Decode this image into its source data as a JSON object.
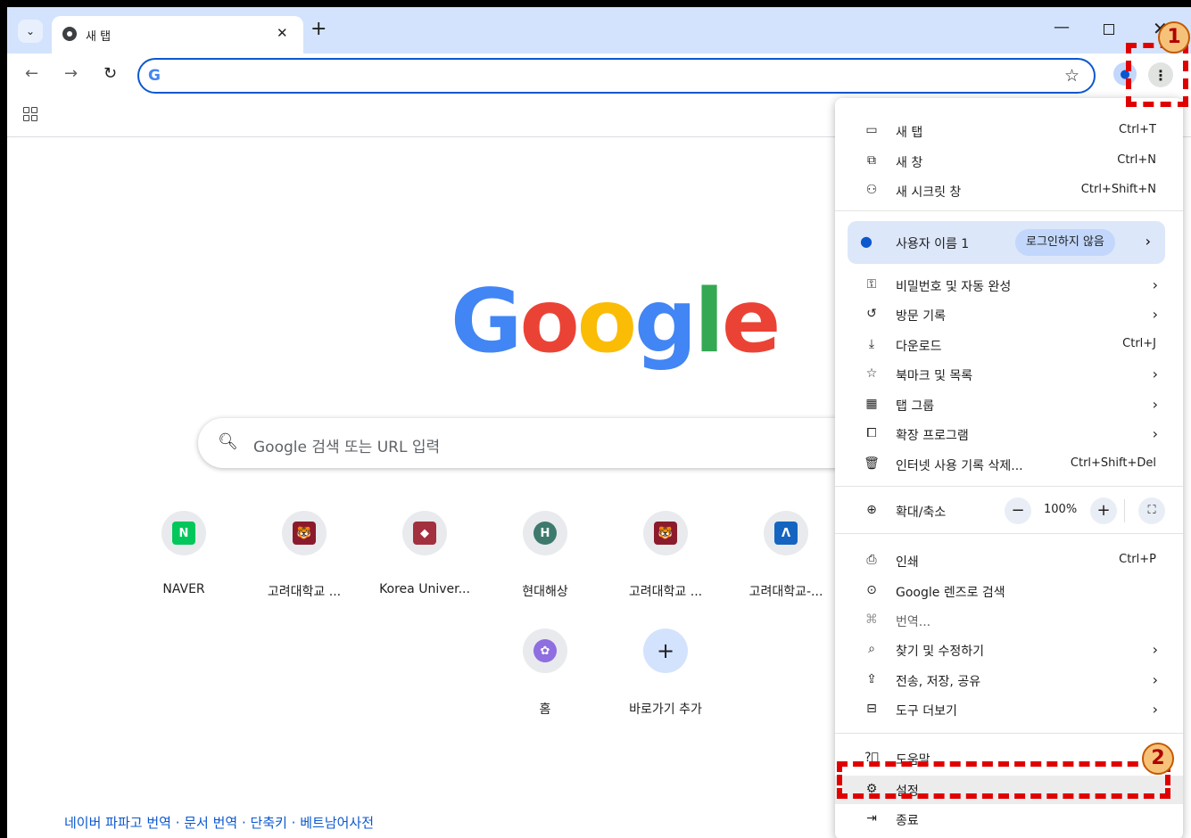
{
  "tab": {
    "title": "새 탭"
  },
  "page": {
    "logo_letters": [
      {
        "char": "G",
        "color": "#4285f4"
      },
      {
        "char": "o",
        "color": "#ea4335"
      },
      {
        "char": "o",
        "color": "#fbbc05"
      },
      {
        "char": "g",
        "color": "#4285f4"
      },
      {
        "char": "l",
        "color": "#34a853"
      },
      {
        "char": "e",
        "color": "#ea4335"
      }
    ],
    "search_placeholder": "Google 검색 또는 URL 입력",
    "shortcuts": [
      {
        "label": "NAVER",
        "icon": "naver-icon",
        "color": "#03c75a",
        "glyph": "N"
      },
      {
        "label": "고려대학교 ...",
        "icon": "korea-univ-tiger-icon",
        "color": "#8b1b2c",
        "glyph": "🐯"
      },
      {
        "label": "Korea Univer...",
        "icon": "korea-univ-shield-icon",
        "color": "#a3303f",
        "glyph": "◆"
      },
      {
        "label": "현대해상",
        "icon": "hyundai-marine-icon",
        "color": "#3d7a6d",
        "glyph": "H"
      },
      {
        "label": "고려대학교 ...",
        "icon": "korea-univ-tiger-icon",
        "color": "#8b1b2c",
        "glyph": "🐯"
      },
      {
        "label": "고려대학교-...",
        "icon": "blackboard-icon",
        "color": "#1565c0",
        "glyph": "Λ"
      },
      {
        "label": "홈",
        "icon": "copilot-icon",
        "color": "#8e6ee0",
        "glyph": "✿"
      },
      {
        "label": "바로가기 추가",
        "icon": "add-shortcut-icon",
        "color": "#d3e3fd",
        "glyph": "+"
      }
    ],
    "footer": "네이버 파파고 번역 · 문서 번역 · 단축키 · 베트남어사전"
  },
  "menu": {
    "new_tab": {
      "label": "새 탭",
      "shortcut": "Ctrl+T"
    },
    "new_window": {
      "label": "새 창",
      "shortcut": "Ctrl+N"
    },
    "incognito": {
      "label": "새 시크릿 창",
      "shortcut": "Ctrl+Shift+N"
    },
    "profile": {
      "label": "사용자 이름 1",
      "status": "로그인하지 않음"
    },
    "passwords": {
      "label": "비밀번호 및 자동 완성"
    },
    "history": {
      "label": "방문 기록"
    },
    "downloads": {
      "label": "다운로드",
      "shortcut": "Ctrl+J"
    },
    "bookmarks": {
      "label": "북마크 및 목록"
    },
    "tab_groups": {
      "label": "탭 그룹"
    },
    "extensions": {
      "label": "확장 프로그램"
    },
    "clear_data": {
      "label": "인터넷 사용 기록 삭제...",
      "shortcut": "Ctrl+Shift+Del"
    },
    "zoom": {
      "label": "확대/축소",
      "value": "100%"
    },
    "print": {
      "label": "인쇄",
      "shortcut": "Ctrl+P"
    },
    "lens": {
      "label": "Google 렌즈로 검색"
    },
    "translate": {
      "label": "번역..."
    },
    "find_edit": {
      "label": "찾기 및 수정하기"
    },
    "cast_save_share": {
      "label": "전송, 저장, 공유"
    },
    "more_tools": {
      "label": "도구 더보기"
    },
    "help": {
      "label": "도움말"
    },
    "settings": {
      "label": "설정"
    },
    "exit": {
      "label": "종료"
    }
  },
  "annotations": {
    "badge1": "1",
    "badge2": "2",
    "color": "#e00000"
  }
}
